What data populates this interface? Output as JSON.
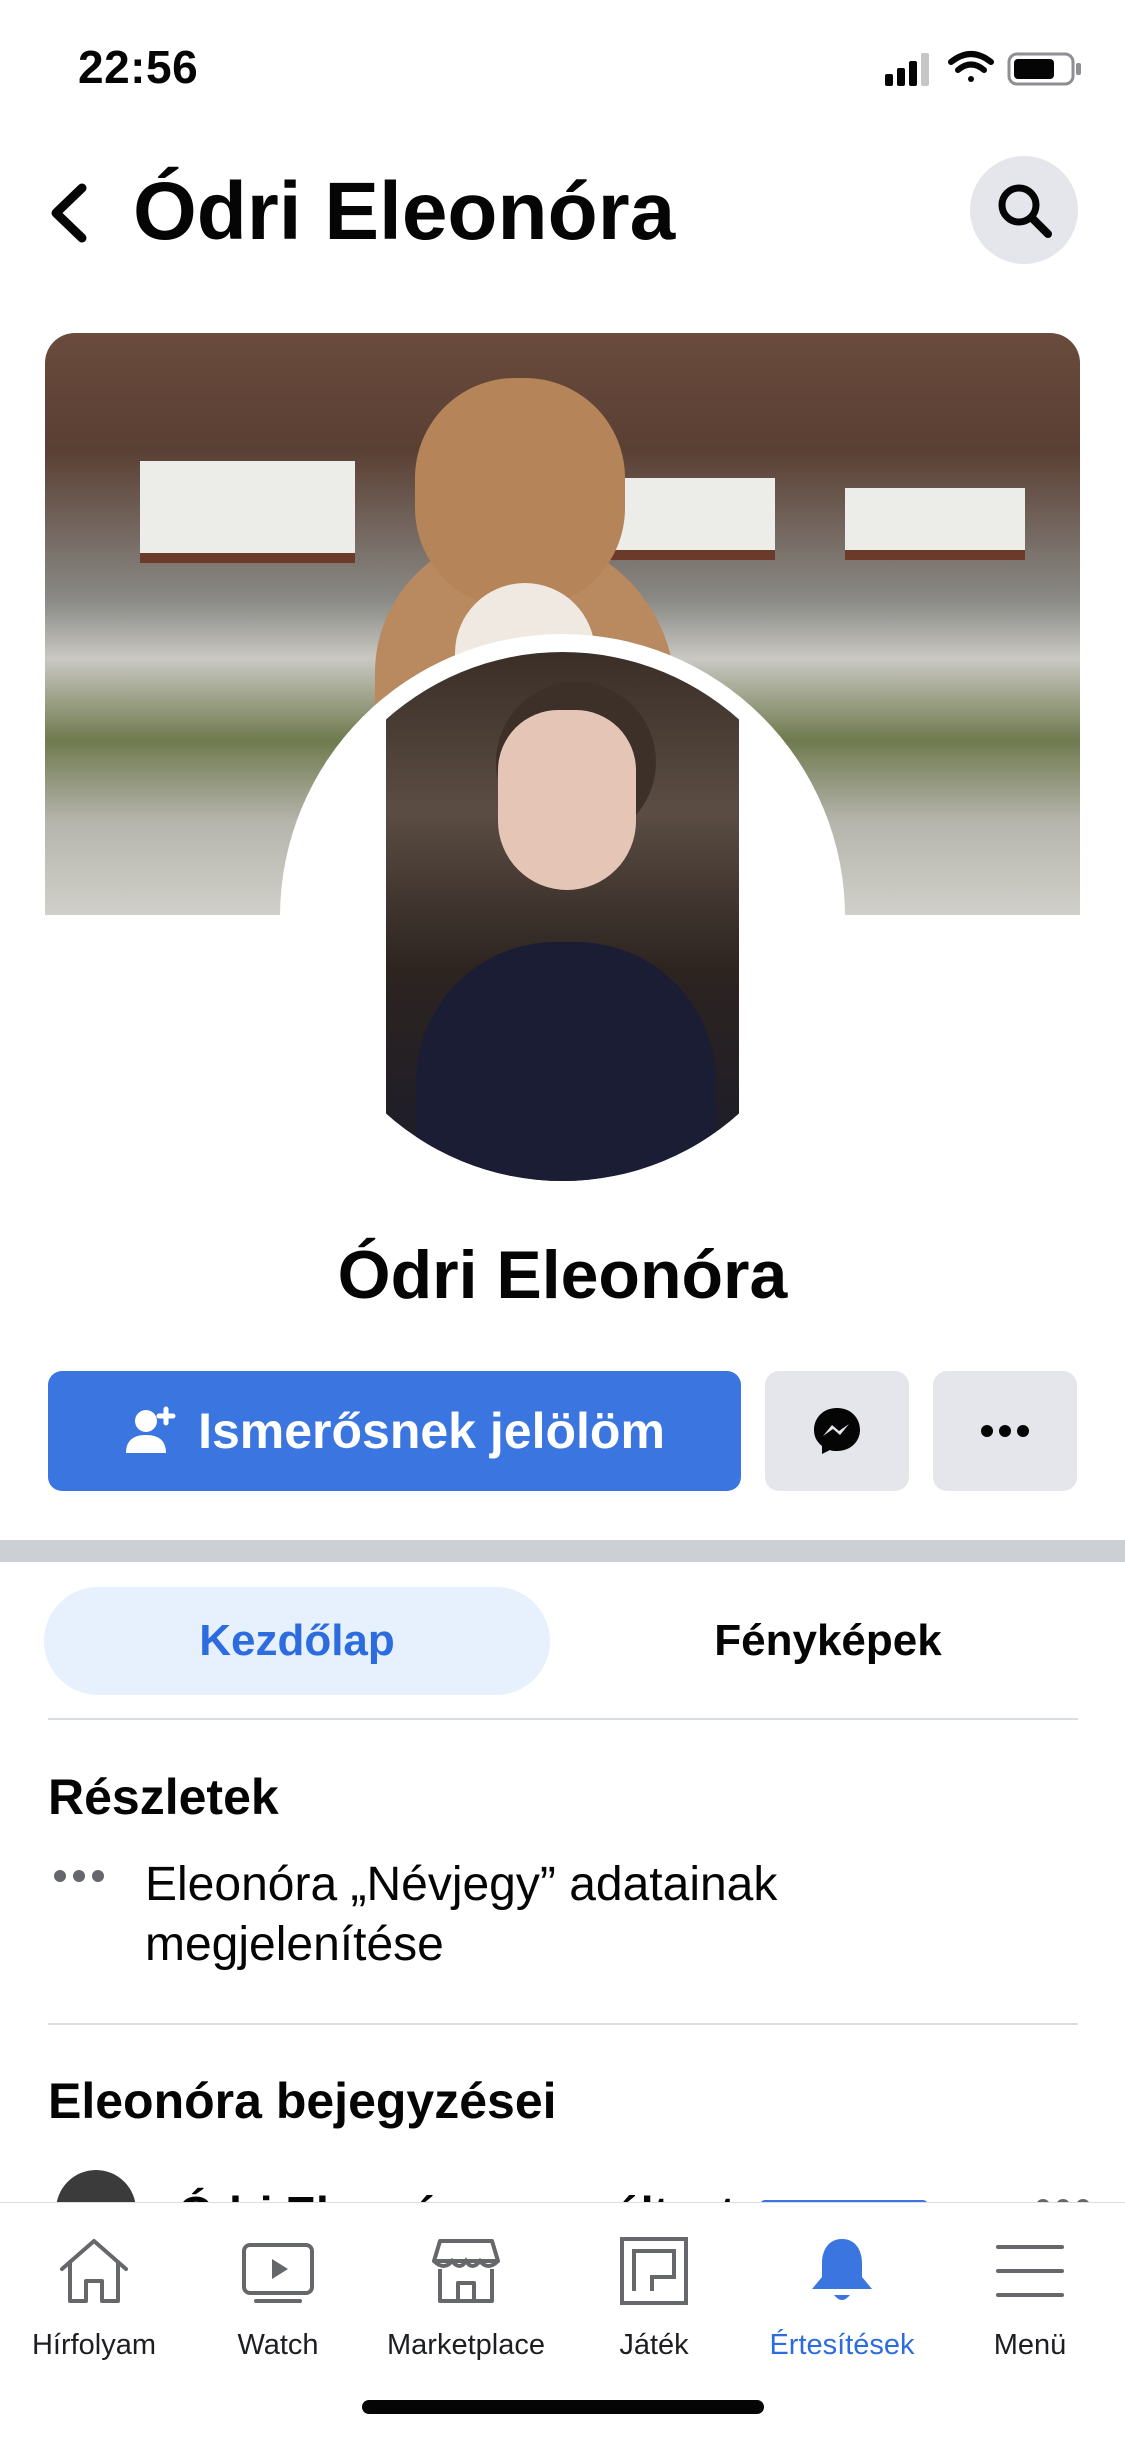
{
  "status_bar": {
    "time": "22:56"
  },
  "header": {
    "title": "Ódri Eleonóra"
  },
  "profile": {
    "name": "Ódri Eleonóra"
  },
  "actions": {
    "add_friend_label": "Ismerősnek jelölöm"
  },
  "tabs": [
    {
      "label": "Kezdőlap",
      "active": true
    },
    {
      "label": "Fényképek",
      "active": false
    }
  ],
  "details": {
    "title": "Részletek",
    "line1": "Eleonóra „Névjegy” adatainak",
    "line2": "megjelenítése"
  },
  "posts": {
    "title": "Eleonóra bejegyzései",
    "first_post_text": "Ódri Eleonóra megváltoztatt"
  },
  "tab_bar": [
    {
      "label": "Hírfolyam",
      "icon": "home-icon",
      "active": false
    },
    {
      "label": "Watch",
      "icon": "watch-icon",
      "active": false
    },
    {
      "label": "Marketplace",
      "icon": "marketplace-icon",
      "active": false
    },
    {
      "label": "Játék",
      "icon": "gaming-icon",
      "active": false
    },
    {
      "label": "Értesítések",
      "icon": "bell-icon",
      "active": true
    },
    {
      "label": "Menü",
      "icon": "menu-icon",
      "active": false
    }
  ],
  "colors": {
    "accent": "#3a75e0",
    "accent_text": "#2d6cdf",
    "gray_button": "#e4e6eb",
    "active_tab_bg": "#e7f0fd"
  }
}
